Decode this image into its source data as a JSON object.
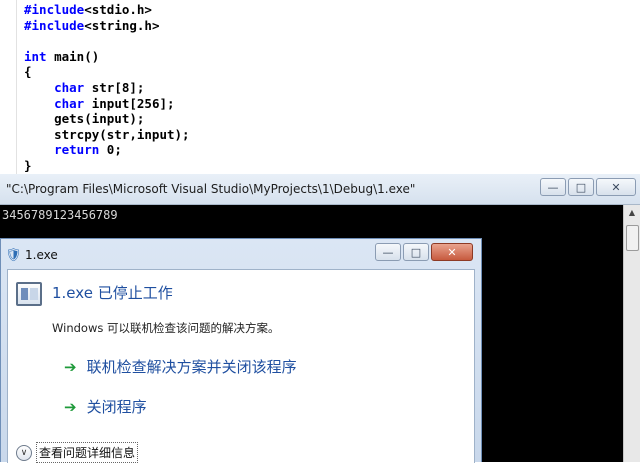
{
  "editor": {
    "lines": [
      [
        {
          "t": "#include",
          "kw": true
        },
        {
          "t": "<stdio.h>"
        }
      ],
      [
        {
          "t": "#include",
          "kw": true
        },
        {
          "t": "<string.h>"
        }
      ],
      [],
      [
        {
          "t": "int",
          "kw": true
        },
        {
          "t": " main()"
        }
      ],
      [
        {
          "t": "{"
        }
      ],
      [
        {
          "t": "    "
        },
        {
          "t": "char",
          "kw": true
        },
        {
          "t": " str[8];"
        }
      ],
      [
        {
          "t": "    "
        },
        {
          "t": "char",
          "kw": true
        },
        {
          "t": " input[256];"
        }
      ],
      [
        {
          "t": "    gets(input);"
        }
      ],
      [
        {
          "t": "    strcpy(str,input);"
        }
      ],
      [
        {
          "t": "    "
        },
        {
          "t": "return",
          "kw": true
        },
        {
          "t": " 0;"
        }
      ],
      [
        {
          "t": "}"
        }
      ]
    ]
  },
  "console": {
    "title": "\"C:\\Program Files\\Microsoft Visual Studio\\MyProjects\\1\\Debug\\1.exe\"",
    "output": "3456789123456789",
    "buttons": {
      "minimize": "—",
      "maximize": "□",
      "close": "✕"
    }
  },
  "dialog": {
    "title": "1.exe",
    "heading": "1.exe 已停止工作",
    "description": "Windows 可以联机检查该问题的解决方案。",
    "option_check_online": "联机检查解决方案并关闭该程序",
    "option_close": "关闭程序",
    "details_label": "查看问题详细信息",
    "buttons": {
      "minimize": "—",
      "maximize": "□",
      "close": "✕"
    }
  },
  "colors": {
    "keyword": "#0000ff",
    "console_bg": "#000000",
    "link_blue": "#1f4fa0",
    "green_arrow": "#1f9a3a"
  },
  "icons": {
    "dialog_app": "shield-icon",
    "option_arrow": "green-arrow-icon",
    "details_toggle": "chevron-down-icon"
  }
}
